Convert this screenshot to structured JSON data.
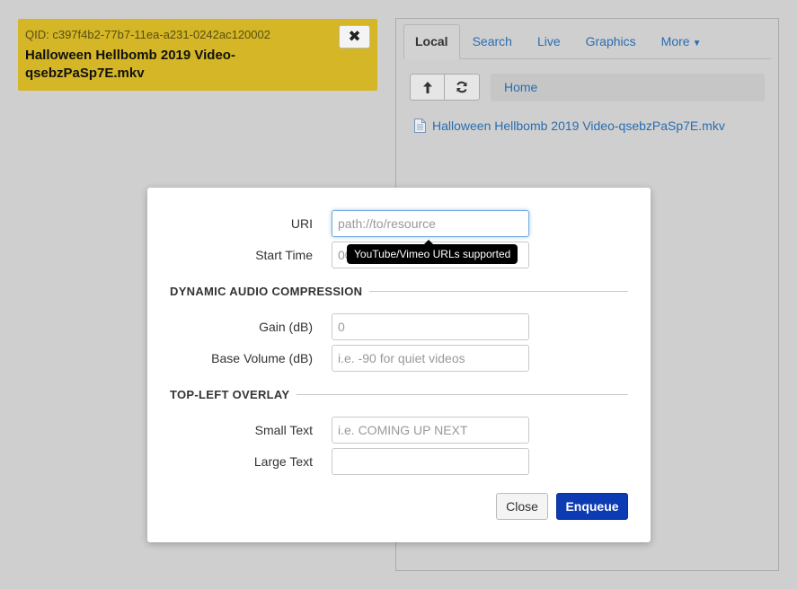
{
  "queue_item": {
    "qid": "QID: c397f4b2-77b7-11ea-a231-0242ac120002",
    "title": "Halloween Hellbomb 2019 Video-qsebzPaSp7E.mkv",
    "close_label": "✖",
    "color": "#d4b626"
  },
  "browser": {
    "tabs": [
      {
        "label": "Local",
        "active": true
      },
      {
        "label": "Search",
        "active": false
      },
      {
        "label": "Live",
        "active": false
      },
      {
        "label": "Graphics",
        "active": false
      },
      {
        "label": "More",
        "active": false
      }
    ],
    "toolbar": {
      "up_icon": "arrow-up-icon",
      "refresh_icon": "refresh-icon"
    },
    "breadcrumb": "Home",
    "files": [
      {
        "name": "Halloween Hellbomb 2019 Video-qsebzPaSp7E.mkv",
        "icon": "file-icon"
      }
    ]
  },
  "modal": {
    "uri": {
      "label": "URI",
      "placeholder": "path://to/resource",
      "value": ""
    },
    "start_time": {
      "label": "Start Time",
      "placeholder": "00:00:00",
      "value": ""
    },
    "tooltip": "YouTube/Vimeo URLs supported",
    "section_audio": "DYNAMIC AUDIO COMPRESSION",
    "gain": {
      "label": "Gain (dB)",
      "placeholder": "0",
      "value": ""
    },
    "base_volume": {
      "label": "Base Volume (dB)",
      "placeholder": "i.e. -90 for quiet videos",
      "value": ""
    },
    "section_overlay": "TOP-LEFT OVERLAY",
    "small_text": {
      "label": "Small Text",
      "placeholder": "i.e. COMING UP NEXT",
      "value": ""
    },
    "large_text": {
      "label": "Large Text",
      "placeholder": "",
      "value": ""
    },
    "close_label": "Close",
    "enqueue_label": "Enqueue"
  },
  "colors": {
    "link": "#2a6db0",
    "primary_button": "#0c3bb3",
    "background": "#cfcfcf"
  }
}
